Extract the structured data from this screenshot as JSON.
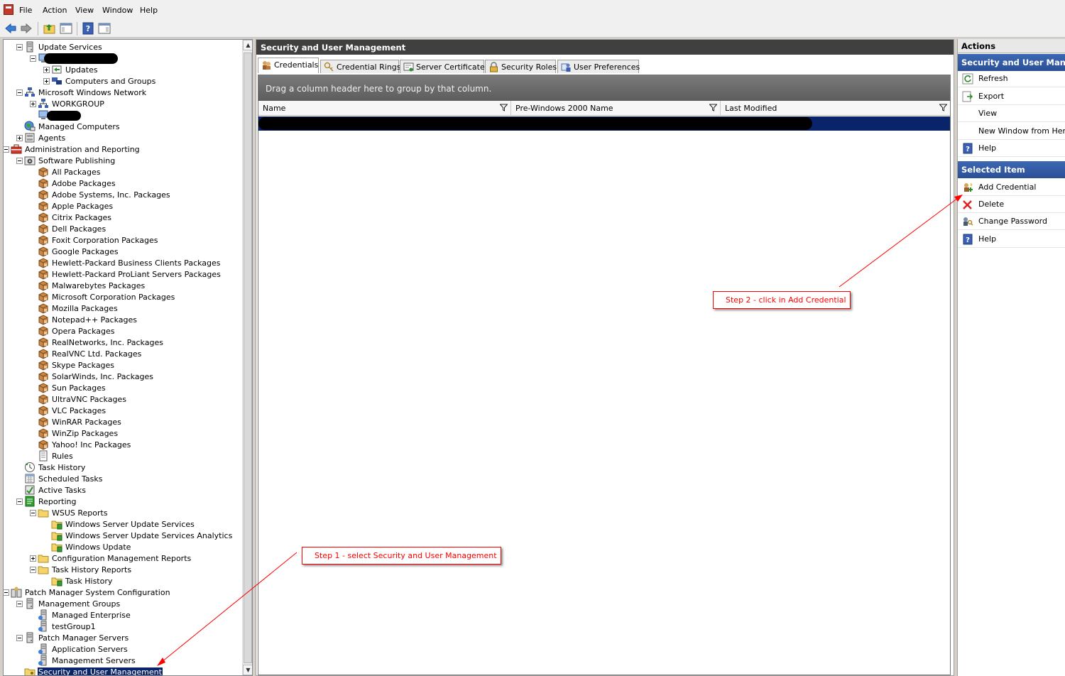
{
  "menu": {
    "items": [
      "File",
      "Action",
      "View",
      "Window",
      "Help"
    ]
  },
  "tree": {
    "items": [
      {
        "label": "Update Services",
        "icon": "server-icon",
        "expander": "minus"
      },
      {
        "label": "",
        "icon": "computer-icon",
        "expander": "minus"
      },
      {
        "label": "Updates",
        "icon": "updates-icon",
        "expander": "plus"
      },
      {
        "label": "Computers and Groups",
        "icon": "computers-icon",
        "expander": "plus"
      },
      {
        "label": "Microsoft Windows Network",
        "icon": "network-icon",
        "expander": "minus"
      },
      {
        "label": "WORKGROUP",
        "icon": "workgroup-icon",
        "expander": "plus"
      },
      {
        "label": "",
        "icon": "computer-icon",
        "expander": "none"
      },
      {
        "label": "Managed Computers",
        "icon": "globe-computers-icon",
        "expander": "none"
      },
      {
        "label": "Agents",
        "icon": "agents-icon",
        "expander": "plus"
      },
      {
        "label": "Administration and Reporting",
        "icon": "toolbox-icon",
        "expander": "minus"
      },
      {
        "label": "Software Publishing",
        "icon": "software-publishing-icon",
        "expander": "minus"
      },
      {
        "label": "All Packages",
        "icon": "package-icon",
        "expander": "none"
      },
      {
        "label": "Adobe Packages",
        "icon": "package-icon",
        "expander": "none"
      },
      {
        "label": "Adobe Systems, Inc. Packages",
        "icon": "package-icon",
        "expander": "none"
      },
      {
        "label": "Apple Packages",
        "icon": "package-icon",
        "expander": "none"
      },
      {
        "label": "Citrix Packages",
        "icon": "package-icon",
        "expander": "none"
      },
      {
        "label": "Dell Packages",
        "icon": "package-icon",
        "expander": "none"
      },
      {
        "label": "Foxit Corporation Packages",
        "icon": "package-icon",
        "expander": "none"
      },
      {
        "label": "Google Packages",
        "icon": "package-icon",
        "expander": "none"
      },
      {
        "label": "Hewlett-Packard Business Clients Packages",
        "icon": "package-icon",
        "expander": "none"
      },
      {
        "label": "Hewlett-Packard ProLiant Servers Packages",
        "icon": "package-icon",
        "expander": "none"
      },
      {
        "label": "Malwarebytes Packages",
        "icon": "package-icon",
        "expander": "none"
      },
      {
        "label": "Microsoft Corporation Packages",
        "icon": "package-icon",
        "expander": "none"
      },
      {
        "label": "Mozilla Packages",
        "icon": "package-icon",
        "expander": "none"
      },
      {
        "label": "Notepad++ Packages",
        "icon": "package-icon",
        "expander": "none"
      },
      {
        "label": "Opera Packages",
        "icon": "package-icon",
        "expander": "none"
      },
      {
        "label": "RealNetworks, Inc. Packages",
        "icon": "package-icon",
        "expander": "none"
      },
      {
        "label": "RealVNC Ltd. Packages",
        "icon": "package-icon",
        "expander": "none"
      },
      {
        "label": "Skype Packages",
        "icon": "package-icon",
        "expander": "none"
      },
      {
        "label": "SolarWinds, Inc. Packages",
        "icon": "package-icon",
        "expander": "none"
      },
      {
        "label": "Sun Packages",
        "icon": "package-icon",
        "expander": "none"
      },
      {
        "label": "UltraVNC Packages",
        "icon": "package-icon",
        "expander": "none"
      },
      {
        "label": "VLC Packages",
        "icon": "package-icon",
        "expander": "none"
      },
      {
        "label": "WinRAR Packages",
        "icon": "package-icon",
        "expander": "none"
      },
      {
        "label": "WinZip Packages",
        "icon": "package-icon",
        "expander": "none"
      },
      {
        "label": "Yahoo! Inc Packages",
        "icon": "package-icon",
        "expander": "none"
      },
      {
        "label": "Rules",
        "icon": "rules-icon",
        "expander": "none"
      },
      {
        "label": "Task History",
        "icon": "task-history-icon",
        "expander": "none"
      },
      {
        "label": "Scheduled Tasks",
        "icon": "scheduled-tasks-icon",
        "expander": "none"
      },
      {
        "label": "Active Tasks",
        "icon": "active-tasks-icon",
        "expander": "none"
      },
      {
        "label": "Reporting",
        "icon": "reporting-icon",
        "expander": "minus"
      },
      {
        "label": "WSUS Reports",
        "icon": "folder-icon",
        "expander": "minus"
      },
      {
        "label": "Windows Server Update Services",
        "icon": "report-folder-icon",
        "expander": "none"
      },
      {
        "label": "Windows Server Update Services Analytics",
        "icon": "report-folder-icon",
        "expander": "none"
      },
      {
        "label": "Windows Update",
        "icon": "report-folder-icon",
        "expander": "none"
      },
      {
        "label": "Configuration Management Reports",
        "icon": "folder-icon",
        "expander": "plus"
      },
      {
        "label": "Task History Reports",
        "icon": "folder-icon",
        "expander": "minus"
      },
      {
        "label": "Task History",
        "icon": "report-folder-icon",
        "expander": "none"
      },
      {
        "label": "Patch Manager System Configuration",
        "icon": "config-icon",
        "expander": "minus"
      },
      {
        "label": "Management Groups",
        "icon": "management-groups-icon",
        "expander": "minus"
      },
      {
        "label": "Managed Enterprise",
        "icon": "enterprise-icon",
        "expander": "none"
      },
      {
        "label": "testGroup1",
        "icon": "group-icon",
        "expander": "none"
      },
      {
        "label": "Patch Manager Servers",
        "icon": "servers-icon",
        "expander": "minus"
      },
      {
        "label": "Application Servers",
        "icon": "app-servers-icon",
        "expander": "none"
      },
      {
        "label": "Management Servers",
        "icon": "mgmt-servers-icon",
        "expander": "none"
      },
      {
        "label": "Security and User Management",
        "icon": "security-folder-icon",
        "expander": "none",
        "selected": true
      }
    ]
  },
  "center": {
    "title": "Security and User Management",
    "tabs": [
      {
        "label": "Credentials",
        "icon": "credentials-icon",
        "active": true
      },
      {
        "label": "Credential Rings",
        "icon": "credential-rings-icon"
      },
      {
        "label": "Server Certificates",
        "icon": "certificate-icon"
      },
      {
        "label": "Security Roles",
        "icon": "lock-icon"
      },
      {
        "label": "User Preferences",
        "icon": "user-preferences-icon"
      }
    ],
    "group_panel_text": "Drag a column header here to group by that column.",
    "columns": [
      "Name",
      "Pre-Windows 2000 Name",
      "Last Modified"
    ]
  },
  "actions": {
    "title": "Actions",
    "section1": "Security and User Management",
    "section1_items": [
      {
        "label": "Refresh",
        "icon": "refresh-icon"
      },
      {
        "label": "Export",
        "icon": "export-icon"
      },
      {
        "label": "View",
        "icon": ""
      },
      {
        "label": "New Window from Here",
        "icon": ""
      },
      {
        "label": "Help",
        "icon": "help-icon"
      }
    ],
    "section2": "Selected Item",
    "section2_items": [
      {
        "label": "Add Credential",
        "icon": "add-credential-icon"
      },
      {
        "label": "Delete",
        "icon": "delete-icon"
      },
      {
        "label": "Change Password",
        "icon": "change-password-icon"
      },
      {
        "label": "Help",
        "icon": "help-icon"
      }
    ]
  },
  "annotations": {
    "step1": "Step 1 - select Security and User Management",
    "step2": "Step 2 - click in Add Credential"
  },
  "colors": {
    "selection": "#0a246a",
    "section_header": "#2a4f96",
    "annotation": "#ff0000"
  }
}
